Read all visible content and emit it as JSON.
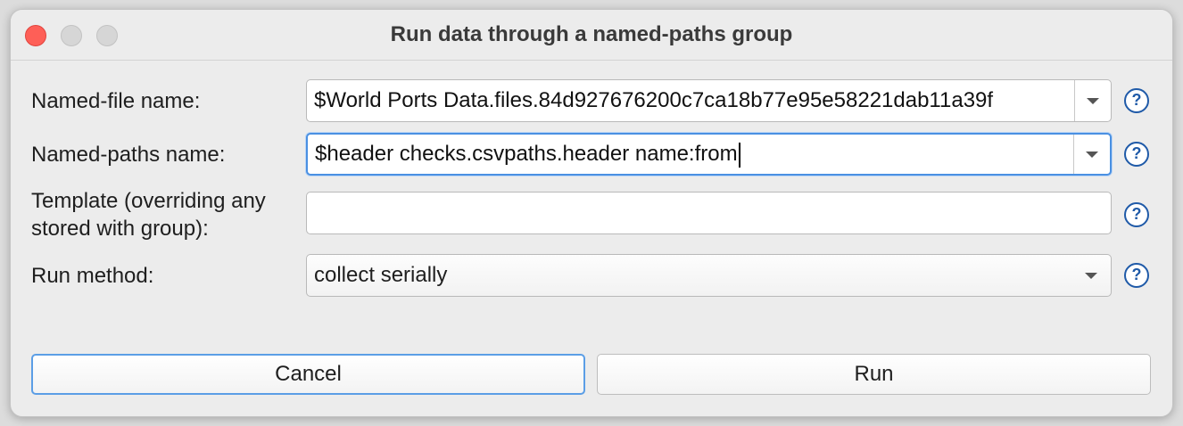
{
  "window": {
    "title": "Run data through a named-paths group"
  },
  "form": {
    "named_file": {
      "label": "Named-file name:",
      "value": "$World Ports Data.files.84d927676200c7ca18b77e95e58221dab11a39f"
    },
    "named_paths": {
      "label": "Named-paths name:",
      "value": "$header checks.csvpaths.header name:from"
    },
    "template": {
      "label_line1": "Template (overriding any",
      "label_line2": "stored with group):",
      "value": ""
    },
    "run_method": {
      "label": "Run method:",
      "value": "collect serially"
    },
    "help_glyph": "?"
  },
  "buttons": {
    "cancel": "Cancel",
    "run": "Run"
  },
  "colors": {
    "close": "#fe5f57",
    "focus": "#4a90e2",
    "help": "#1f5aa8"
  },
  "icons": [
    "close-icon",
    "minimize-icon",
    "maximize-icon",
    "chevron-down-icon",
    "help-icon"
  ]
}
